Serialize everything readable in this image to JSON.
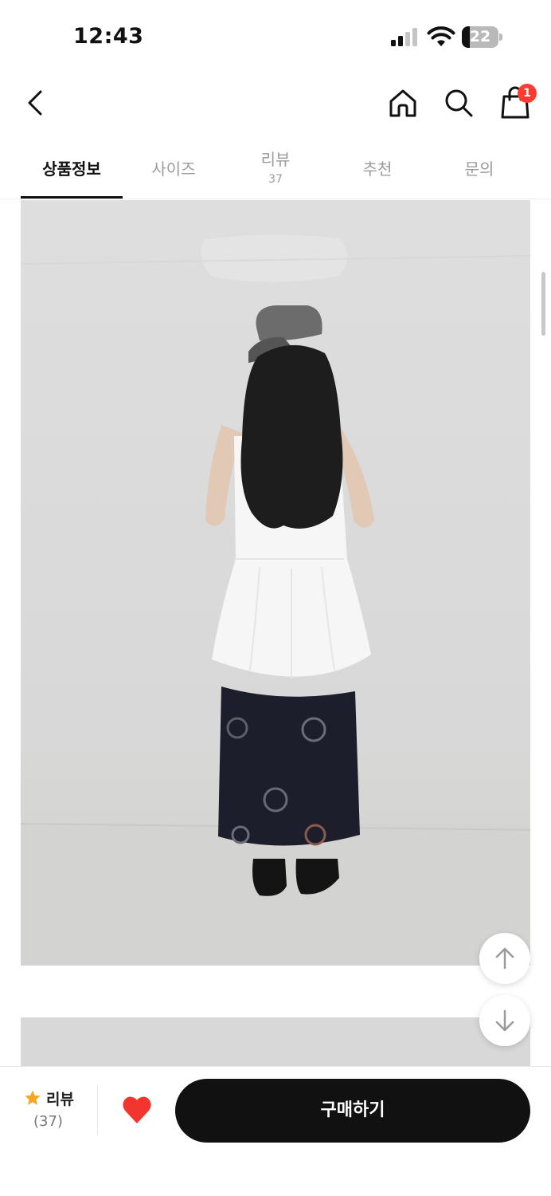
{
  "status_bar": {
    "time": "12:43",
    "battery": "22",
    "battery_level": 0.22,
    "icons": [
      "signal-icon",
      "wifi-icon",
      "battery-icon"
    ]
  },
  "header": {
    "icons": [
      "back-icon",
      "home-icon",
      "search-icon",
      "cart-icon"
    ],
    "cart_badge": "1"
  },
  "tabs": [
    {
      "label": "상품정보",
      "count": "",
      "active": true
    },
    {
      "label": "사이즈",
      "count": ""
    },
    {
      "label": "리뷰",
      "count": "37"
    },
    {
      "label": "추천",
      "count": ""
    },
    {
      "label": "문의",
      "count": ""
    }
  ],
  "floating_buttons": [
    "arrow-up-icon",
    "arrow-down-icon"
  ],
  "bottom_bar": {
    "review_label": "리뷰",
    "review_count": "(37)",
    "buy_label": "구매하기"
  },
  "colors": {
    "accent": "#111111",
    "badge": "#ff3b30",
    "heart": "#f2362f",
    "star": "#f5a623"
  }
}
